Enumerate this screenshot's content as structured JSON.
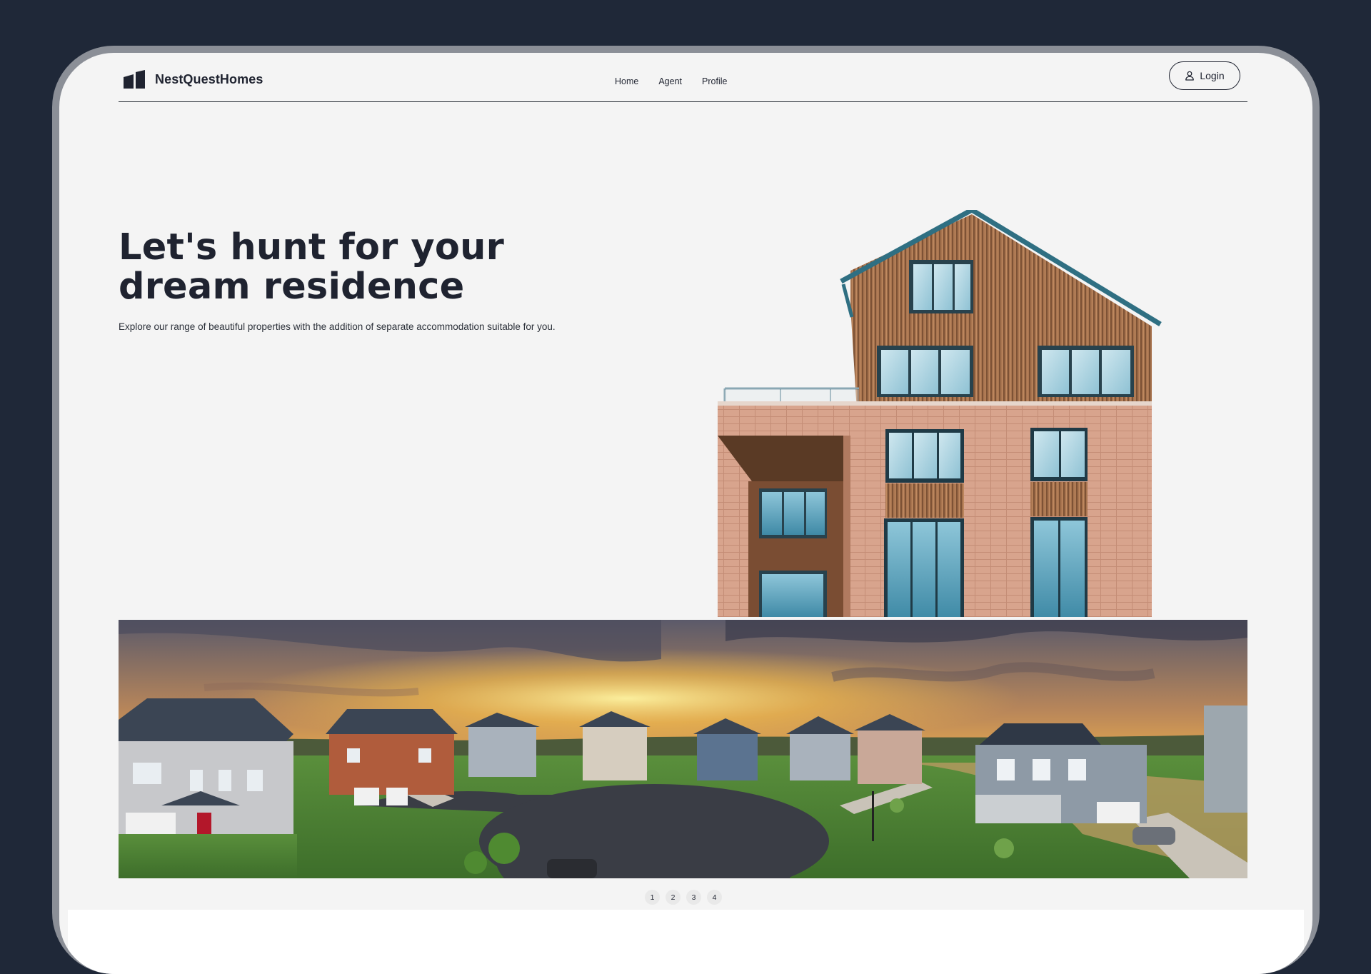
{
  "brand": {
    "name": "NestQuestHomes",
    "logo_icon": "building-logo-icon"
  },
  "nav": {
    "items": [
      {
        "label": "Home"
      },
      {
        "label": "Agent"
      },
      {
        "label": "Profile"
      }
    ]
  },
  "login": {
    "label": "Login",
    "icon": "user-icon"
  },
  "hero": {
    "title": "Let's hunt for your dream residence",
    "subtitle": "Explore our range of beautiful properties with the addition of separate accommodation suitable for you."
  },
  "pagination": {
    "pages": [
      "1",
      "2",
      "3",
      "4"
    ]
  },
  "colors": {
    "background": "#1f2838",
    "screen": "#f4f4f4",
    "text": "#1f2330"
  }
}
